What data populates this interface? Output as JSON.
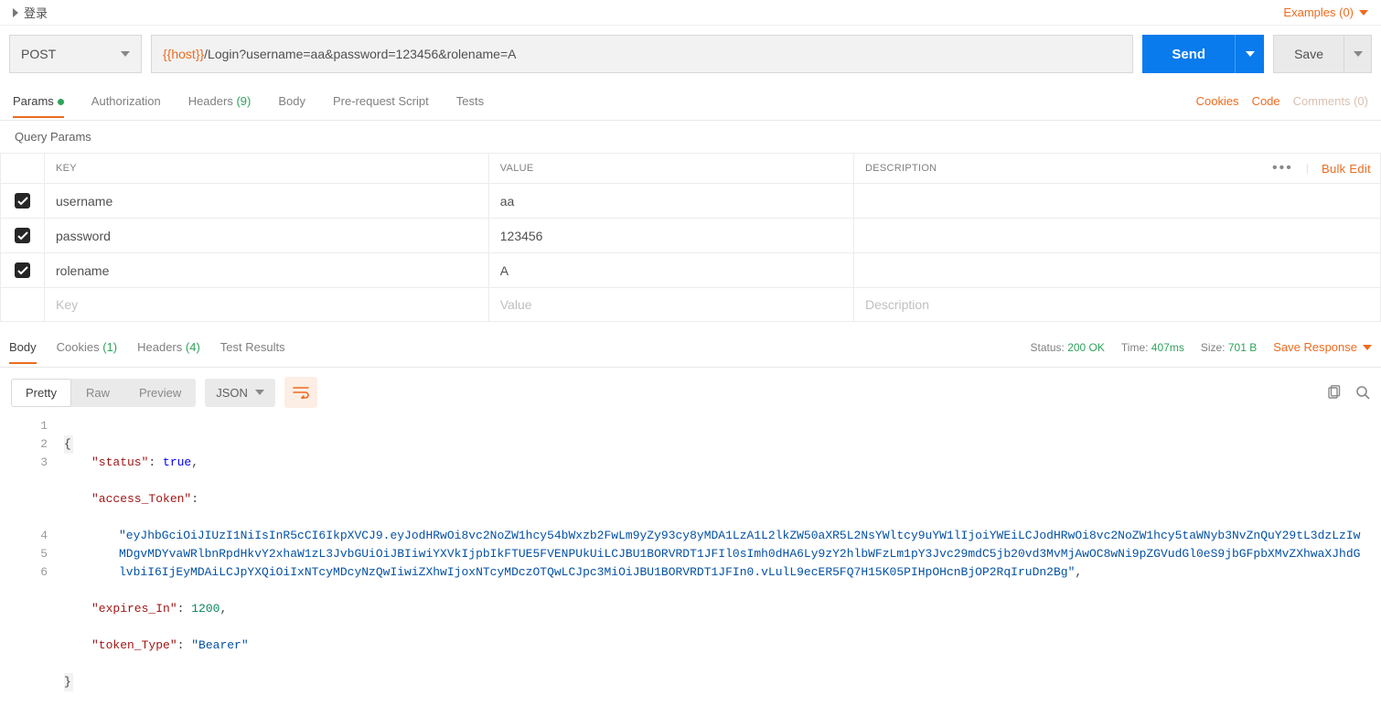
{
  "header": {
    "request_name": "登录",
    "examples_label": "Examples (0)"
  },
  "request": {
    "method": "POST",
    "url_variable": "{{host}}",
    "url_rest": "/Login?username=aa&password=123456&rolename=A",
    "send_label": "Send",
    "save_label": "Save"
  },
  "tabs": {
    "params": "Params",
    "authorization": "Authorization",
    "headers": "Headers",
    "headers_count": "(9)",
    "body": "Body",
    "prerequest": "Pre-request Script",
    "tests": "Tests",
    "cookies": "Cookies",
    "code": "Code",
    "comments": "Comments (0)"
  },
  "query": {
    "title": "Query Params",
    "col_key": "KEY",
    "col_value": "VALUE",
    "col_desc": "DESCRIPTION",
    "bulk_edit": "Bulk Edit",
    "rows": [
      {
        "key": "username",
        "value": "aa",
        "desc": ""
      },
      {
        "key": "password",
        "value": "123456",
        "desc": ""
      },
      {
        "key": "rolename",
        "value": "A",
        "desc": ""
      }
    ],
    "ph_key": "Key",
    "ph_value": "Value",
    "ph_desc": "Description"
  },
  "response": {
    "tabs": {
      "body": "Body",
      "cookies": "Cookies",
      "cookies_count": "(1)",
      "headers": "Headers",
      "headers_count": "(4)",
      "test_results": "Test Results"
    },
    "status_label": "Status:",
    "status_value": "200 OK",
    "time_label": "Time:",
    "time_value": "407ms",
    "size_label": "Size:",
    "size_value": "701 B",
    "save_response": "Save Response",
    "view": {
      "pretty": "Pretty",
      "raw": "Raw",
      "preview": "Preview",
      "lang": "JSON"
    },
    "json": {
      "status_key": "\"status\"",
      "status_val": "true",
      "token_key": "\"access_Token\"",
      "token_val": "\"eyJhbGciOiJIUzI1NiIsInR5cCI6IkpXVCJ9.eyJodHRwOi8vc2NoZW1hcy54bWxzb2FwLm9yZy93cy8yMDA1LzA1L2lkZW50aXR5L2NsYWltcy9uYW1lIjoiYWEiLCJodHRwOi8vc2NoZW1hcy5taWNyb3NvZnQuY29tL3dzLzIwMDgvMDYvaWRlbnRpdHkvY2xhaW1zL3JvbGUiOiJBIiwiYXVkIjpbIkFTUE5FVENPUkUiLCJBU1BORVRDT1JFIl0sImh0dHA6Ly9zY2hlbWFzLm1pY3Jvc29mdC5jb20vd3MvMjAwOC8wNi9pZGVudGl0eS9jbGFpbXMvZXhwaXJhdGlvbiI6IjEyMDAiLCJpYXQiOiIxNTcyMDcyNzQwIiwiZXhwIjoxNTcyMDczOTQwLCJpc3MiOiJBU1BORVRDT1JFIn0.vLulL9ecER5FQ7H15K05PIHpOHcnBjOP2RqIruDn2Bg\"",
      "expires_key": "\"expires_In\"",
      "expires_val": "1200",
      "type_key": "\"token_Type\"",
      "type_val": "\"Bearer\""
    }
  }
}
